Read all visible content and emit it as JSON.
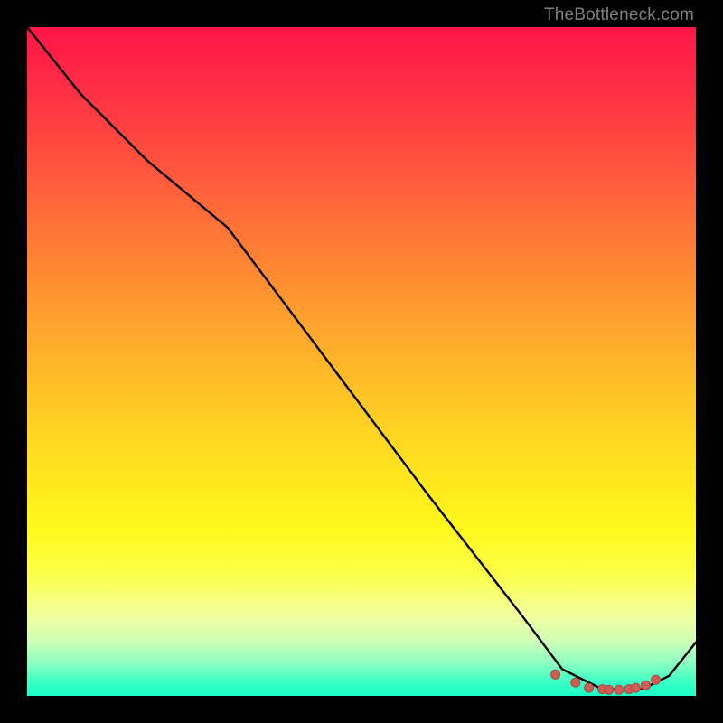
{
  "watermark": "TheBottleneck.com",
  "colors": {
    "background": "#000000",
    "curve_stroke": "#000000",
    "marker_fill": "#cf5d56",
    "marker_stroke": "#a74840",
    "watermark_text": "#808080"
  },
  "chart_data": {
    "type": "line",
    "title": "",
    "xlabel": "",
    "ylabel": "",
    "xlim": [
      0,
      100
    ],
    "ylim": [
      0,
      100
    ],
    "grid": false,
    "series": [
      {
        "name": "bottleneck-curve",
        "x": [
          0,
          8,
          18,
          30,
          45,
          60,
          74,
          80,
          86,
          92,
          96,
          100
        ],
        "y": [
          100,
          90,
          80,
          70,
          50,
          30,
          12,
          4,
          1,
          1,
          3,
          8
        ]
      }
    ],
    "markers": {
      "name": "minimum-region",
      "x": [
        79,
        82,
        84,
        86,
        87,
        88.5,
        90,
        91,
        92.5,
        94
      ],
      "y": [
        3.2,
        2,
        1.2,
        1,
        0.9,
        0.9,
        1,
        1.2,
        1.6,
        2.4
      ]
    }
  }
}
